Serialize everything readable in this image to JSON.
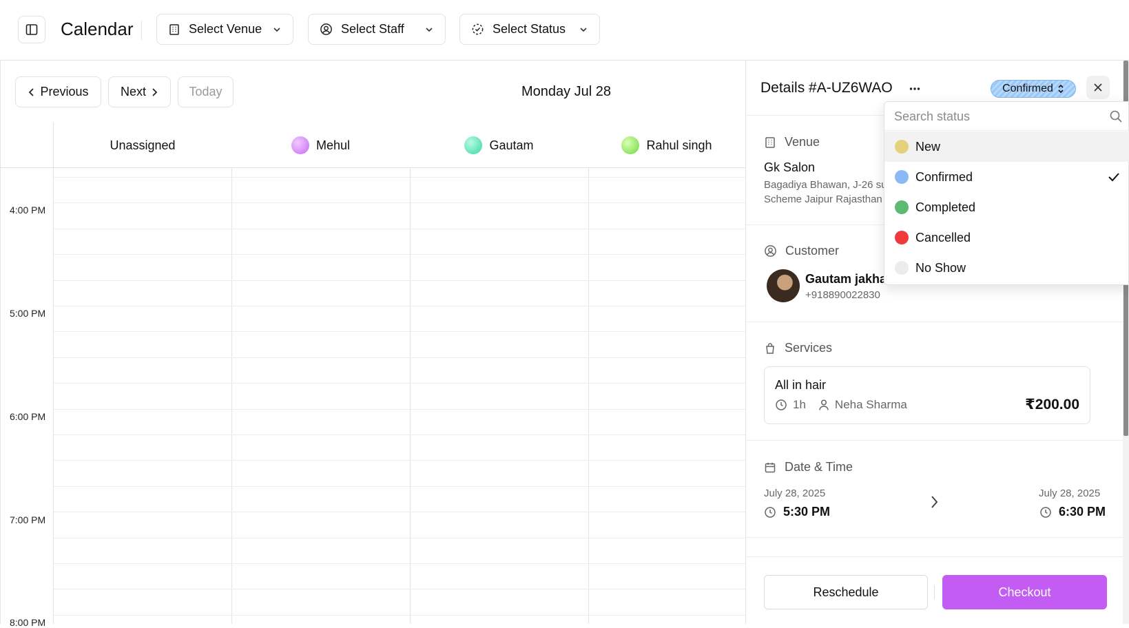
{
  "header": {
    "title": "Calendar",
    "filters": {
      "venue": "Select Venue",
      "staff": "Select Staff",
      "status": "Select Status"
    }
  },
  "nav": {
    "previous": "Previous",
    "next": "Next",
    "today": "Today",
    "date": "Monday Jul 28"
  },
  "staff": [
    {
      "name": "Unassigned"
    },
    {
      "name": "Mehul",
      "color": "#d48df3"
    },
    {
      "name": "Gautam",
      "color": "#52e0b4"
    },
    {
      "name": "Rahul singh",
      "color": "#8fe25e"
    }
  ],
  "times": [
    "4:00 PM",
    "5:00 PM",
    "6:00 PM",
    "7:00 PM",
    "8:00 PM"
  ],
  "details": {
    "title": "Details #A-UZ6WAO",
    "status": "Confirmed",
    "venue": {
      "heading": "Venue",
      "name": "Gk Salon",
      "address_line1": "Bagadiya Bhawan, J-26 su",
      "address_line2": "Scheme Jaipur Rajasthan"
    },
    "customer": {
      "heading": "Customer",
      "name": "Gautam jakha",
      "phone": "+918890022830"
    },
    "services": {
      "heading": "Services",
      "name": "All in hair",
      "duration": "1h",
      "staff": "Neha Sharma",
      "price": "₹200.00"
    },
    "datetime": {
      "heading": "Date & Time",
      "start_date": "July 28, 2025",
      "start_time": "5:30 PM",
      "end_date": "July 28, 2025",
      "end_time": "6:30 PM"
    },
    "actions": {
      "reschedule": "Reschedule",
      "checkout": "Checkout"
    }
  },
  "status_dropdown": {
    "placeholder": "Search status",
    "options": [
      {
        "label": "New",
        "color": "#e4d17a"
      },
      {
        "label": "Confirmed",
        "color": "#8ab9f6",
        "selected": true
      },
      {
        "label": "Completed",
        "color": "#5dba72"
      },
      {
        "label": "Cancelled",
        "color": "#ee3a3a"
      },
      {
        "label": "No Show",
        "color": "#ececec"
      }
    ]
  },
  "colors": {
    "accent": "#c35cf2",
    "status_pill": "#9cc8f7"
  }
}
